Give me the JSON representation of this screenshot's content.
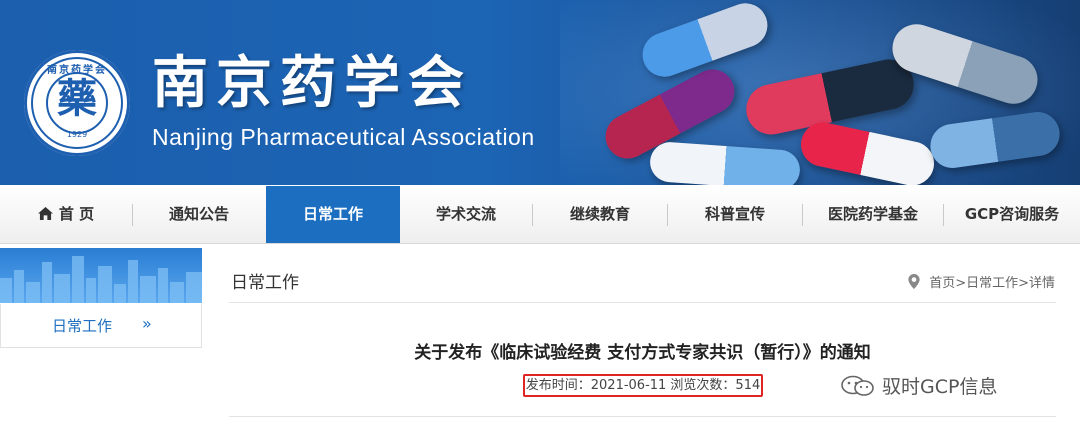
{
  "banner": {
    "title_cn": "南京药学会",
    "title_en": "Nanjing Pharmaceutical Association",
    "logo": {
      "arc_text": "南京药学会",
      "center_char": "藥",
      "year": "1929",
      "side_text": "NANJING PHARMACEUTICAL ASSOCIATION"
    }
  },
  "nav": {
    "items": [
      {
        "label": "首 页",
        "icon": "home-icon"
      },
      {
        "label": "通知公告"
      },
      {
        "label": "日常工作",
        "active": true
      },
      {
        "label": "学术交流"
      },
      {
        "label": "继续教育"
      },
      {
        "label": "科普宣传"
      },
      {
        "label": "医院药学基金"
      },
      {
        "label": "GCP咨询服务"
      }
    ],
    "active_color": "#1c6fc0"
  },
  "sidebar": {
    "item_label": "日常工作",
    "item_arrow": "»"
  },
  "main": {
    "section_title": "日常工作",
    "breadcrumb": "首页>日常工作>详情",
    "article_title": "关于发布《临床试验经费 支付方式专家共识（暂行）》的通知",
    "meta": "发布时间：2021-06-11 浏览次数：514"
  },
  "watermark": {
    "text": "驭时GCP信息",
    "icon": "wechat-icon"
  },
  "colors": {
    "banner_blue": "#1b5fae",
    "highlight_red": "#e02424"
  }
}
